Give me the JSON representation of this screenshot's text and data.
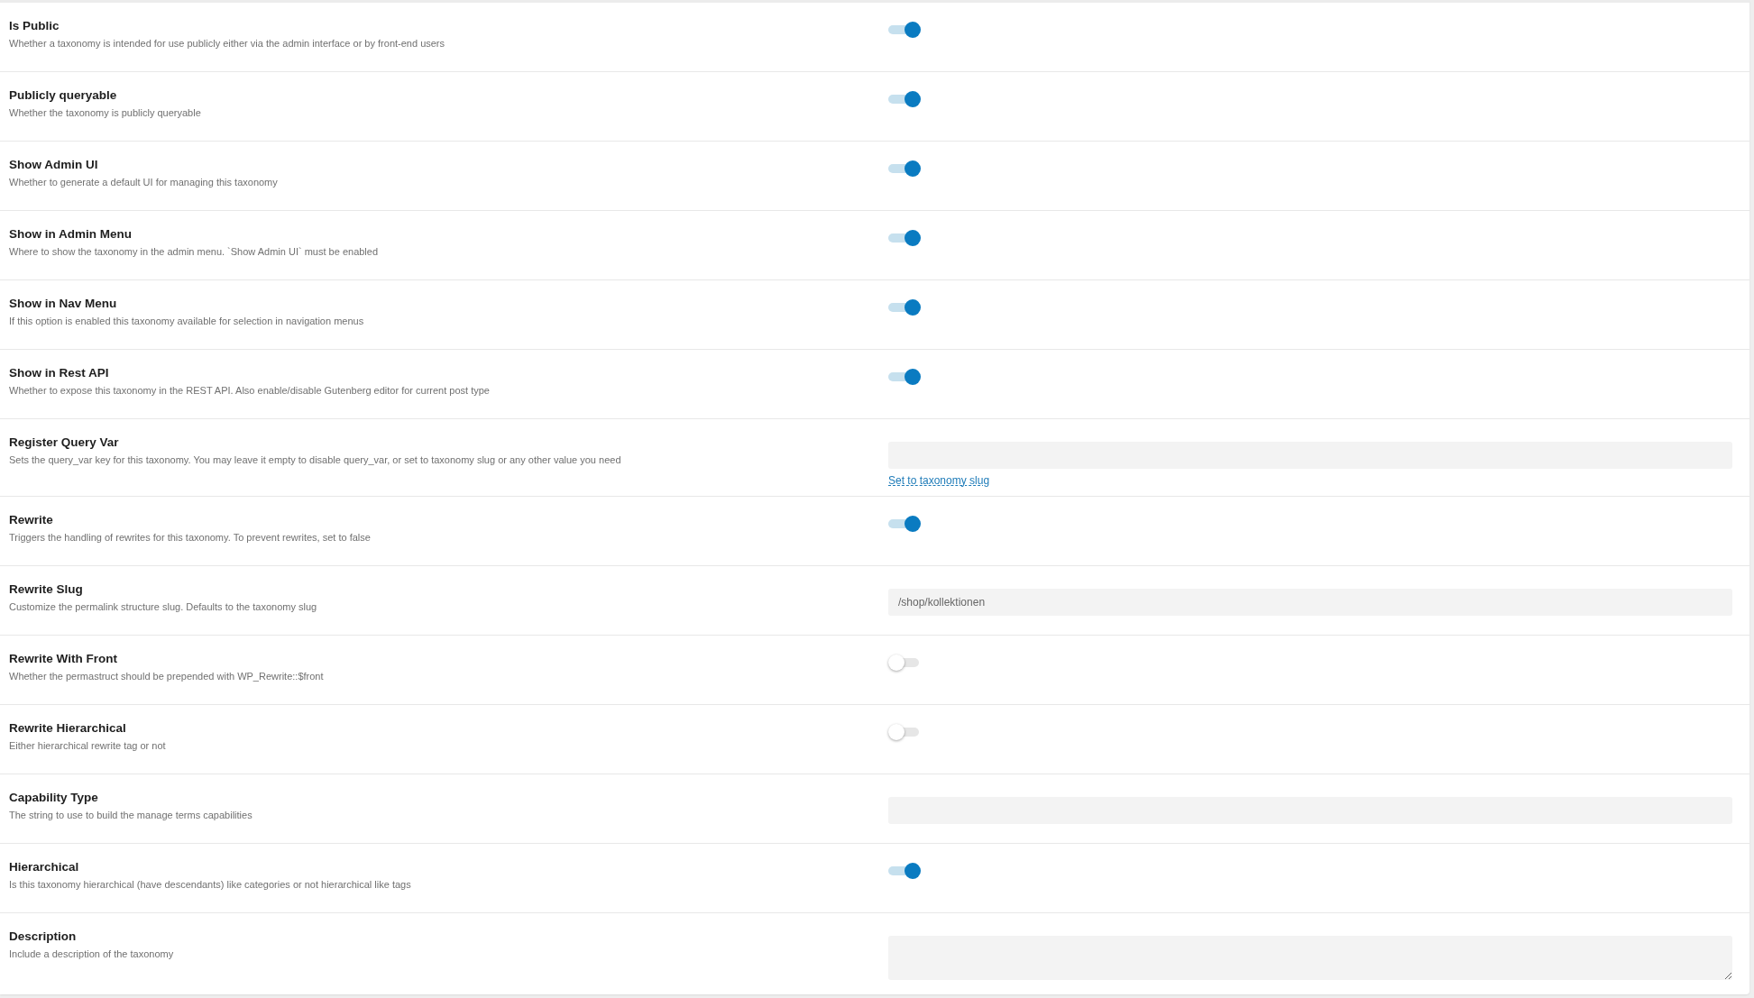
{
  "settings": [
    {
      "title": "Is Public",
      "description": "Whether a taxonomy is intended for use publicly either via the admin interface or by front-end users",
      "kind": "toggle",
      "on": true
    },
    {
      "title": "Publicly queryable",
      "description": "Whether the taxonomy is publicly queryable",
      "kind": "toggle",
      "on": true
    },
    {
      "title": "Show Admin UI",
      "description": "Whether to generate a default UI for managing this taxonomy",
      "kind": "toggle",
      "on": true
    },
    {
      "title": "Show in Admin Menu",
      "description": "Where to show the taxonomy in the admin menu. `Show Admin UI` must be enabled",
      "kind": "toggle",
      "on": true
    },
    {
      "title": "Show in Nav Menu",
      "description": "If this option is enabled this taxonomy available for selection in navigation menus",
      "kind": "toggle",
      "on": true
    },
    {
      "title": "Show in Rest API",
      "description": "Whether to expose this taxonomy in the REST API. Also enable/disable Gutenberg editor for current post type",
      "kind": "toggle",
      "on": true
    },
    {
      "title": "Register Query Var",
      "description": "Sets the query_var key for this taxonomy. You may leave it empty to disable query_var, or set to taxonomy slug or any other value you need",
      "kind": "text",
      "link": "Set to taxonomy slug"
    },
    {
      "title": "Rewrite",
      "description": "Triggers the handling of rewrites for this taxonomy. To prevent rewrites, set to false",
      "kind": "toggle",
      "on": true
    },
    {
      "title": "Rewrite Slug",
      "description": "Customize the permalink structure slug. Defaults to the taxonomy slug",
      "kind": "text",
      "value": "/shop/kollektionen"
    },
    {
      "title": "Rewrite With Front",
      "description": "Whether the permastruct should be prepended with WP_Rewrite::$front",
      "kind": "toggle",
      "on": false
    },
    {
      "title": "Rewrite Hierarchical",
      "description": "Either hierarchical rewrite tag or not",
      "kind": "toggle",
      "on": false
    },
    {
      "title": "Capability Type",
      "description": "The string to use to build the manage terms capabilities",
      "kind": "text"
    },
    {
      "title": "Hierarchical",
      "description": "Is this taxonomy hierarchical (have descendants) like categories or not hierarchical like tags",
      "kind": "toggle",
      "on": true
    },
    {
      "title": "Description",
      "description": "Include a description of the taxonomy",
      "kind": "textarea"
    }
  ]
}
